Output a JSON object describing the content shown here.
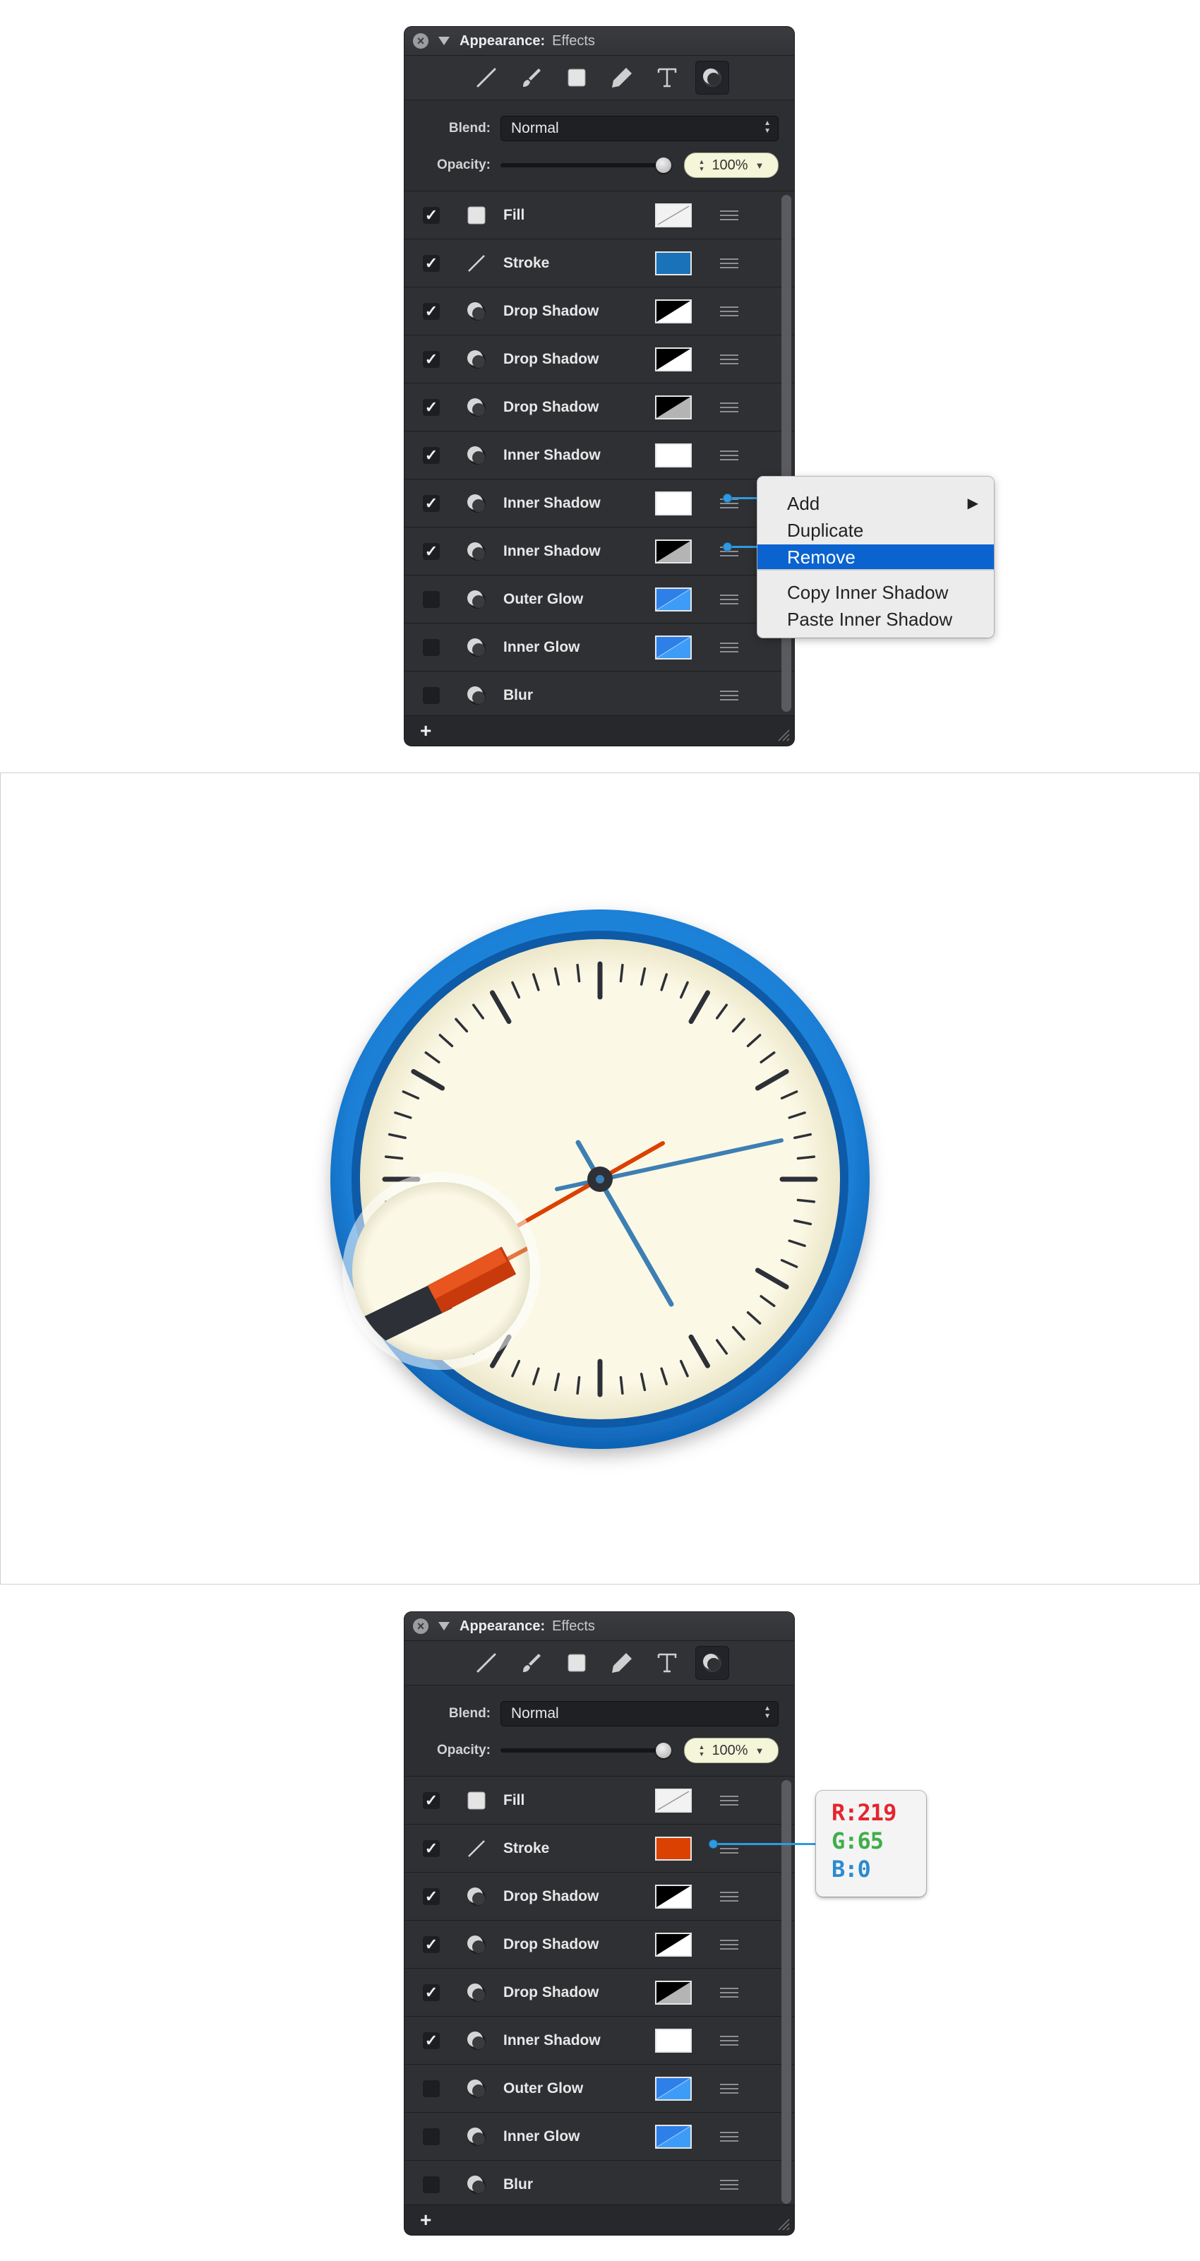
{
  "panel_top": {
    "title_label": "Appearance:",
    "title_value": "Effects",
    "tools": [
      "stroke-line-icon",
      "brush-icon",
      "square-fill-icon",
      "pencil-icon",
      "text-icon",
      "effects-icon"
    ],
    "blend_label": "Blend:",
    "blend_value": "Normal",
    "opacity_label": "Opacity:",
    "opacity_value": "100%",
    "opacity_fraction": 1.0,
    "rows": [
      {
        "label": "Fill",
        "checked": true,
        "icon": "fill-square-icon",
        "swatch": "white-slash"
      },
      {
        "label": "Stroke",
        "checked": true,
        "icon": "stroke-line-icon",
        "swatch": "#1a72b8"
      },
      {
        "label": "Drop Shadow",
        "checked": true,
        "icon": "shadow-icon",
        "swatch": "black-white"
      },
      {
        "label": "Drop Shadow",
        "checked": true,
        "icon": "shadow-icon",
        "swatch": "black-white"
      },
      {
        "label": "Drop Shadow",
        "checked": true,
        "icon": "shadow-icon",
        "swatch": "black-grey"
      },
      {
        "label": "Inner Shadow",
        "checked": true,
        "icon": "shadow-icon",
        "swatch": "#ffffff"
      },
      {
        "label": "Inner Shadow",
        "checked": true,
        "icon": "shadow-icon",
        "swatch": "#ffffff"
      },
      {
        "label": "Inner Shadow",
        "checked": true,
        "icon": "shadow-icon",
        "swatch": "black-grey"
      },
      {
        "label": "Outer Glow",
        "checked": false,
        "icon": "shadow-icon",
        "swatch": "blue"
      },
      {
        "label": "Inner Glow",
        "checked": false,
        "icon": "shadow-icon",
        "swatch": "blue"
      },
      {
        "label": "Blur",
        "checked": false,
        "icon": "shadow-icon",
        "swatch": ""
      }
    ],
    "add_label": "+"
  },
  "context_menu": {
    "items": [
      "Add",
      "Duplicate",
      "Remove",
      "Copy Inner Shadow",
      "Paste Inner Shadow"
    ],
    "highlighted": "Remove",
    "submenu_arrow": "▶"
  },
  "panel_bottom": {
    "title_label": "Appearance:",
    "title_value": "Effects",
    "blend_label": "Blend:",
    "blend_value": "Normal",
    "opacity_label": "Opacity:",
    "opacity_value": "100%",
    "opacity_fraction": 1.0,
    "rows": [
      {
        "label": "Fill",
        "checked": true,
        "icon": "fill-square-icon",
        "swatch": "white-slash"
      },
      {
        "label": "Stroke",
        "checked": true,
        "icon": "stroke-line-icon",
        "swatch": "#db4100"
      },
      {
        "label": "Drop Shadow",
        "checked": true,
        "icon": "shadow-icon",
        "swatch": "black-white"
      },
      {
        "label": "Drop Shadow",
        "checked": true,
        "icon": "shadow-icon",
        "swatch": "black-white"
      },
      {
        "label": "Drop Shadow",
        "checked": true,
        "icon": "shadow-icon",
        "swatch": "black-grey"
      },
      {
        "label": "Inner Shadow",
        "checked": true,
        "icon": "shadow-icon",
        "swatch": "#ffffff"
      },
      {
        "label": "Outer Glow",
        "checked": false,
        "icon": "shadow-icon",
        "swatch": "blue"
      },
      {
        "label": "Inner Glow",
        "checked": false,
        "icon": "shadow-icon",
        "swatch": "blue"
      },
      {
        "label": "Blur",
        "checked": false,
        "icon": "shadow-icon",
        "swatch": ""
      }
    ],
    "add_label": "+"
  },
  "rgb_callout": {
    "r": "R:219",
    "g": "G:65",
    "b": "B:0",
    "r_color": "#e3262f",
    "g_color": "#3fae49",
    "b_color": "#2a8bd0"
  },
  "clock": {
    "rim_color": "#1b7fd6",
    "face_color": "#fbf8e6",
    "tick_color": "#2e3038",
    "hand_color": "#3d7fb3",
    "second_hand_color": "#db4100"
  }
}
